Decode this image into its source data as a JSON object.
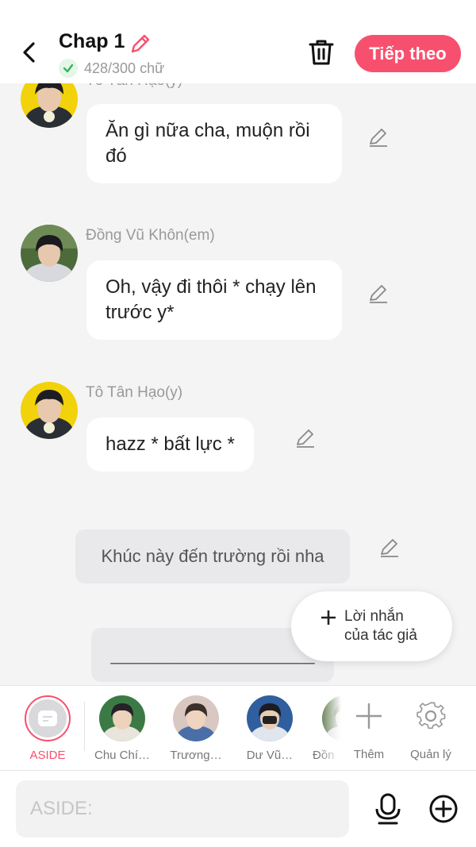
{
  "header": {
    "title": "Chap 1",
    "word_count": "428/300 chữ",
    "next_label": "Tiếp theo",
    "accent_color": "#f7506e"
  },
  "messages": [
    {
      "speaker": "Tô Tân Hạo(y)",
      "text": "Ăn gì nữa cha, muộn rồi đó"
    },
    {
      "speaker": "Đồng Vũ Khôn(em)",
      "text": "Oh,  vậy đi thôi * chạy lên trước y*"
    },
    {
      "speaker": "Tô Tân Hạo(y)",
      "text": "hazz * bất lực *"
    }
  ],
  "asides": [
    {
      "text": "Khúc này đến trường rồi nha"
    },
    {
      "text": "_____________________"
    }
  ],
  "author_note": {
    "line1": "Lời nhắn",
    "line2": "của tác giả"
  },
  "characters": [
    {
      "label": "ASIDE",
      "active": true
    },
    {
      "label": "Chu Chí…"
    },
    {
      "label": "Trương…"
    },
    {
      "label": "Dư Vũ…"
    },
    {
      "label": "Đồn"
    }
  ],
  "bar_actions": {
    "add_label": "Thêm",
    "manage_label": "Quản lý"
  },
  "input": {
    "placeholder": "ASIDE:"
  },
  "icons": [
    "back-icon",
    "pencil-icon",
    "check-icon",
    "trash-icon",
    "plus-icon",
    "gear-icon",
    "mic-icon",
    "add-circle-icon"
  ]
}
